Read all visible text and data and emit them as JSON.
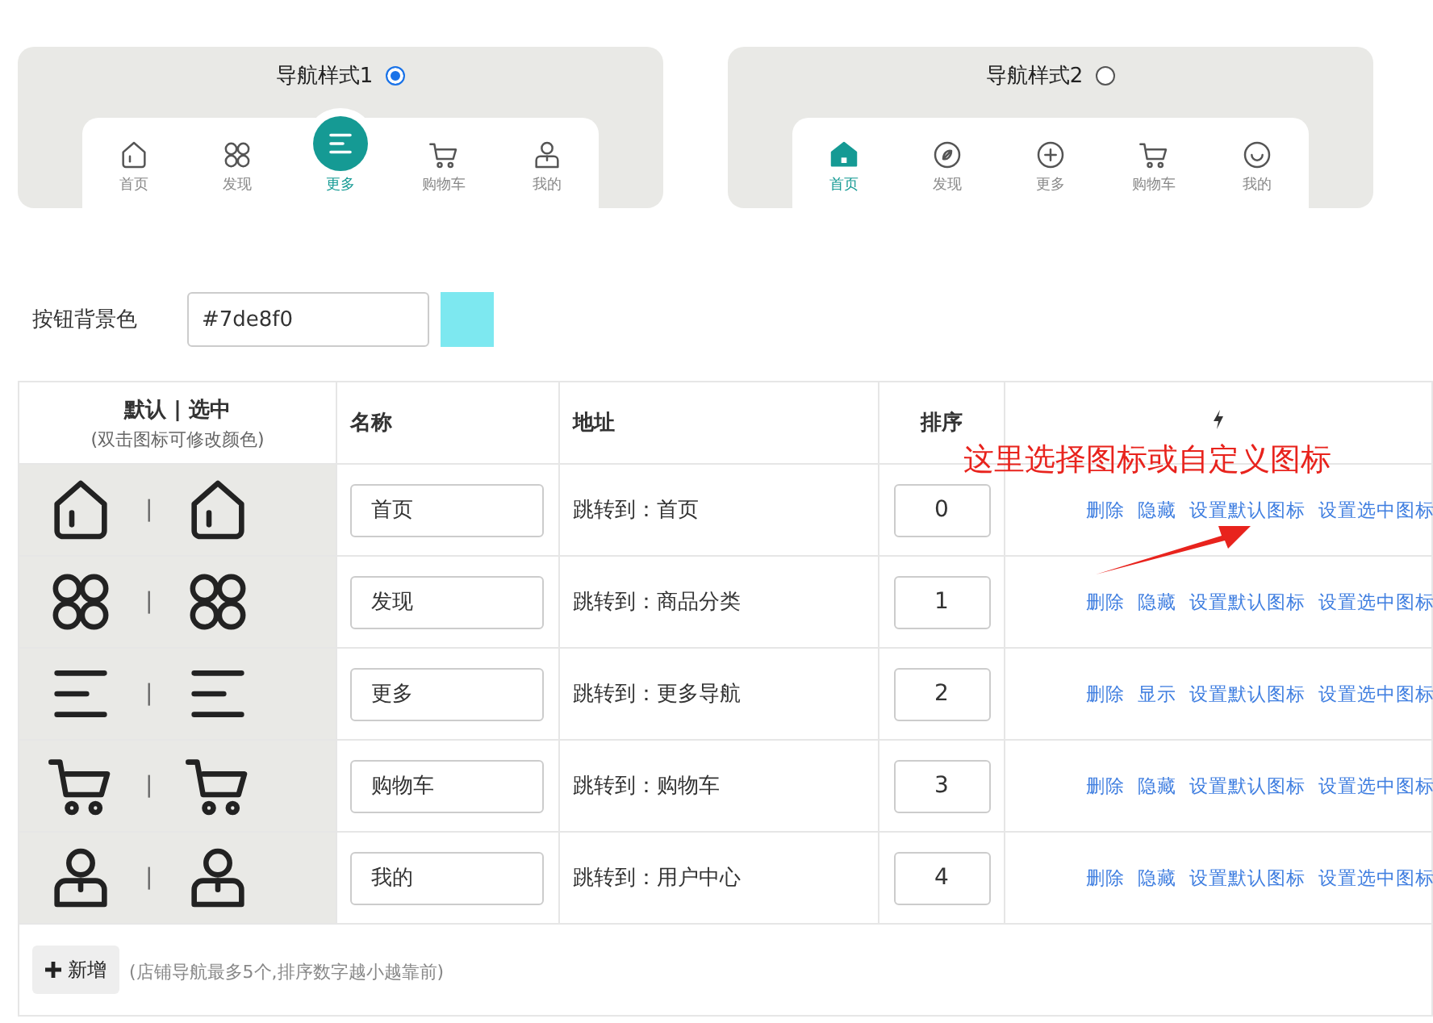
{
  "nav_styles": [
    {
      "label": "导航样式1",
      "selected": true,
      "kind": "raised",
      "items": [
        {
          "label": "首页",
          "kind": "home",
          "active": false
        },
        {
          "label": "发现",
          "kind": "grid",
          "active": false
        },
        {
          "label": "更多",
          "kind": "menu",
          "active": true
        },
        {
          "label": "购物车",
          "kind": "cart",
          "active": false
        },
        {
          "label": "我的",
          "kind": "user",
          "active": false
        }
      ]
    },
    {
      "label": "导航样式2",
      "selected": false,
      "kind": "flat",
      "items": [
        {
          "label": "首页",
          "kind": "home-filled",
          "active": true
        },
        {
          "label": "发现",
          "kind": "compass",
          "active": false
        },
        {
          "label": "更多",
          "kind": "plus",
          "active": false
        },
        {
          "label": "购物车",
          "kind": "cart",
          "active": false
        },
        {
          "label": "我的",
          "kind": "smile",
          "active": false
        }
      ]
    }
  ],
  "color_field": {
    "label": "按钮背景色",
    "value": "#7de8f0"
  },
  "table": {
    "columns": [
      {
        "title": "默认 | 选中",
        "subtitle": "(双击图标可修改颜色)"
      },
      {
        "title": "名称"
      },
      {
        "title": "地址"
      },
      {
        "title": "排序"
      }
    ],
    "rows": [
      {
        "kind": "home",
        "separator": "|",
        "name": "首页",
        "address": "跳转到：首页",
        "sort": "0",
        "actions": [
          "删除",
          "隐藏",
          "设置默认图标",
          "设置选中图标"
        ]
      },
      {
        "kind": "grid",
        "separator": "|",
        "name": "发现",
        "address": "跳转到：商品分类",
        "sort": "1",
        "actions": [
          "删除",
          "隐藏",
          "设置默认图标",
          "设置选中图标"
        ]
      },
      {
        "kind": "menu",
        "separator": "|",
        "name": "更多",
        "address": "跳转到：更多导航",
        "sort": "2",
        "actions": [
          "删除",
          "显示",
          "设置默认图标",
          "设置选中图标"
        ]
      },
      {
        "kind": "cart",
        "separator": "|",
        "name": "购物车",
        "address": "跳转到：购物车",
        "sort": "3",
        "actions": [
          "删除",
          "隐藏",
          "设置默认图标",
          "设置选中图标"
        ]
      },
      {
        "kind": "user",
        "separator": "|",
        "name": "我的",
        "address": "跳转到：用户中心",
        "sort": "4",
        "actions": [
          "删除",
          "隐藏",
          "设置默认图标",
          "设置选中图标"
        ]
      }
    ],
    "add_button": "新增",
    "hint": "(店铺导航最多5个,排序数字越小越靠前)"
  },
  "annotation": "这里选择图标或自定义图标"
}
